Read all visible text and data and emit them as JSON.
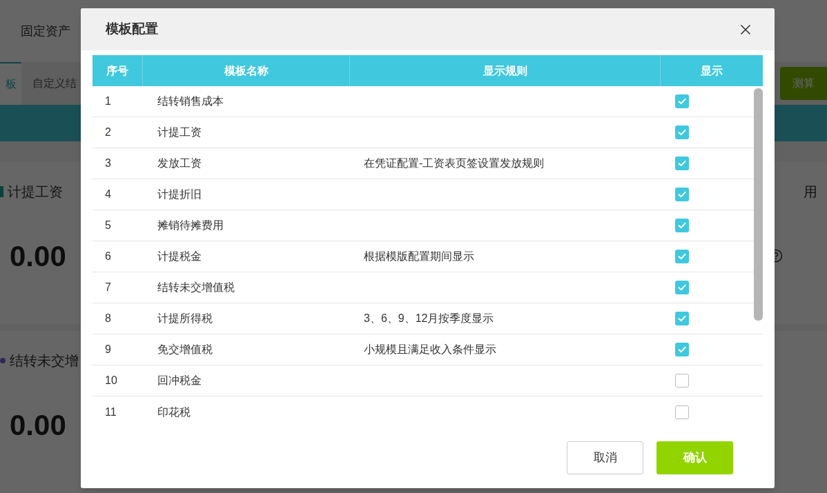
{
  "background": {
    "app_title": "固定资产",
    "tabs": [
      {
        "label": "板",
        "selected": true
      },
      {
        "label": "自定义结",
        "selected": false
      }
    ],
    "action_button": "测算",
    "cards": [
      {
        "title": "计提工资",
        "kind": "bar",
        "color": "#0a413b",
        "amount": "0.00"
      },
      {
        "title": "结转未交增",
        "kind": "dot",
        "color": "#312750",
        "amount": "0.00"
      }
    ],
    "right_card_title": "用"
  },
  "dialog": {
    "title": "模板配置",
    "columns": [
      "序号",
      "模板名称",
      "显示规则",
      "显示"
    ],
    "rows": [
      {
        "index": "1",
        "name": "结转销售成本",
        "checked": true
      },
      {
        "index": "2",
        "name": "计提工资",
        "checked": true
      },
      {
        "index": "3",
        "name": "发放工资",
        "rule": "在凭证配置-工资表页签设置发放规则",
        "checked": true
      },
      {
        "index": "4",
        "name": "计提折旧",
        "checked": true
      },
      {
        "index": "5",
        "name": "摊销待摊费用",
        "checked": true
      },
      {
        "index": "6",
        "name": "计提税金",
        "rule": "根据模版配置期间显示",
        "checked": true
      },
      {
        "index": "7",
        "name": "结转未交增值税",
        "checked": true
      },
      {
        "index": "8",
        "name": "计提所得税",
        "rule": "3、6、9、12月按季度显示",
        "checked": true
      },
      {
        "index": "9",
        "name": "免交增值税",
        "rule": "小规模且满足收入条件显示",
        "checked": true
      },
      {
        "index": "10",
        "name": "回冲税金",
        "checked": false
      },
      {
        "index": "11",
        "name": "印花税",
        "checked": false
      }
    ],
    "buttons": [
      {
        "label": "取消",
        "kind": "secondary"
      },
      {
        "label": "确认",
        "kind": "primary"
      }
    ]
  }
}
